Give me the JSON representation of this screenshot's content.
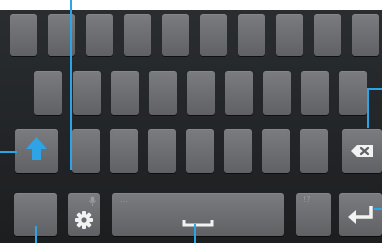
{
  "keyboard": {
    "space_hint": "…",
    "symbols_hint": "!?"
  },
  "colors": {
    "callout": "#2ea3e6",
    "shift_arrow": "#2ea3e6",
    "key_face": "#6b6d70",
    "keyboard_bg": "#222426"
  },
  "icons": {
    "shift": "shift-arrow-icon",
    "delete": "backspace-icon",
    "settings": "gear-icon",
    "voice": "microphone-icon",
    "space": "space-bracket-icon",
    "enter": "enter-arrow-icon"
  }
}
